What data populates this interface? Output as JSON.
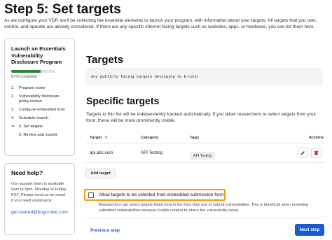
{
  "header": {
    "title": "Step 5: Set targets",
    "intro": "As we configure your VDP, we'll be collecting the essential elements to launch your program, with information about your targets. All targets that you own, control, and operate are already considered. If there are any specific internet facing targets such as websites, apps, or hardware, you can list them here."
  },
  "sidebar": {
    "program_title": "Launch an Essentials Vulnerability Disclosure Program",
    "progress": 0.67,
    "progress_text": "67% complete",
    "progress_color": "#2e8540",
    "steps": [
      {
        "num": "1.",
        "label": "Program name",
        "current": false
      },
      {
        "num": "2.",
        "label": "Vulnerability disclosure policy review",
        "current": false
      },
      {
        "num": "3.",
        "label": "Configure embedded form",
        "current": false
      },
      {
        "num": "4.",
        "label": "Schedule launch",
        "current": false
      },
      {
        "num": "⇒",
        "label": "5. Set targets",
        "current": true
      },
      {
        "num": "",
        "label": "6. Review and submit",
        "current": false
      }
    ],
    "help": {
      "title": "Need help?",
      "text": "Our support team is available 9am to 6pm, Monday to Friday PST. Please send us an email if you need assistance:",
      "email": "get.started@bugcrowd.com"
    }
  },
  "main": {
    "targets_heading": "Targets",
    "targets_value": "Any publicly facing targets belonging to E-Corp",
    "specific_heading": "Specific targets",
    "specific_desc": "Targets in this list will be independently tracked automatically. If you allow researchers to select targets from your form, these will be more prominently visible.",
    "table": {
      "headers": {
        "target": "Target",
        "category": "Category",
        "tags": "Tags",
        "actions": "Actions"
      },
      "rows": [
        {
          "target": "api.abc.com",
          "category": "API Testing",
          "tag": "API Testing"
        }
      ]
    },
    "add_target_label": "Add target",
    "checkbox_label": "Allow targets to be selected from embedded submission form",
    "checkbox_checked": false,
    "checkbox_help": "Researchers can select targets listed here in the form they use to submit vulnerabilities. This is beneficial when reviewing submitted vulnerabilities because it adds context to where the vulnerability exists.",
    "highlight_color": "#f39c12"
  },
  "footer": {
    "previous_label": "Previous step",
    "next_label": "Next step",
    "accent": "#1a5ccf"
  },
  "icons": {
    "sort": "sort-icon",
    "edit": "pencil-icon",
    "delete": "trash-icon"
  }
}
